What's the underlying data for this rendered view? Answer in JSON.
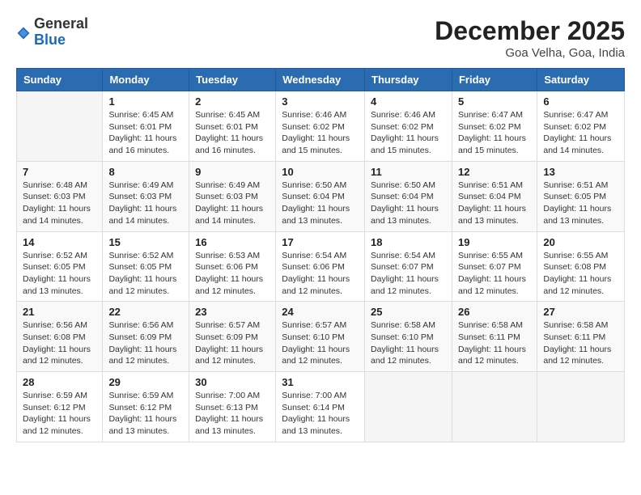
{
  "header": {
    "logo": {
      "general": "General",
      "blue": "Blue"
    },
    "title": "December 2025",
    "subtitle": "Goa Velha, Goa, India"
  },
  "columns": [
    "Sunday",
    "Monday",
    "Tuesday",
    "Wednesday",
    "Thursday",
    "Friday",
    "Saturday"
  ],
  "weeks": [
    [
      {
        "day": "",
        "info": ""
      },
      {
        "day": "1",
        "info": "Sunrise: 6:45 AM\nSunset: 6:01 PM\nDaylight: 11 hours\nand 16 minutes."
      },
      {
        "day": "2",
        "info": "Sunrise: 6:45 AM\nSunset: 6:01 PM\nDaylight: 11 hours\nand 16 minutes."
      },
      {
        "day": "3",
        "info": "Sunrise: 6:46 AM\nSunset: 6:02 PM\nDaylight: 11 hours\nand 15 minutes."
      },
      {
        "day": "4",
        "info": "Sunrise: 6:46 AM\nSunset: 6:02 PM\nDaylight: 11 hours\nand 15 minutes."
      },
      {
        "day": "5",
        "info": "Sunrise: 6:47 AM\nSunset: 6:02 PM\nDaylight: 11 hours\nand 15 minutes."
      },
      {
        "day": "6",
        "info": "Sunrise: 6:47 AM\nSunset: 6:02 PM\nDaylight: 11 hours\nand 14 minutes."
      }
    ],
    [
      {
        "day": "7",
        "info": "Sunrise: 6:48 AM\nSunset: 6:03 PM\nDaylight: 11 hours\nand 14 minutes."
      },
      {
        "day": "8",
        "info": "Sunrise: 6:49 AM\nSunset: 6:03 PM\nDaylight: 11 hours\nand 14 minutes."
      },
      {
        "day": "9",
        "info": "Sunrise: 6:49 AM\nSunset: 6:03 PM\nDaylight: 11 hours\nand 14 minutes."
      },
      {
        "day": "10",
        "info": "Sunrise: 6:50 AM\nSunset: 6:04 PM\nDaylight: 11 hours\nand 13 minutes."
      },
      {
        "day": "11",
        "info": "Sunrise: 6:50 AM\nSunset: 6:04 PM\nDaylight: 11 hours\nand 13 minutes."
      },
      {
        "day": "12",
        "info": "Sunrise: 6:51 AM\nSunset: 6:04 PM\nDaylight: 11 hours\nand 13 minutes."
      },
      {
        "day": "13",
        "info": "Sunrise: 6:51 AM\nSunset: 6:05 PM\nDaylight: 11 hours\nand 13 minutes."
      }
    ],
    [
      {
        "day": "14",
        "info": "Sunrise: 6:52 AM\nSunset: 6:05 PM\nDaylight: 11 hours\nand 13 minutes."
      },
      {
        "day": "15",
        "info": "Sunrise: 6:52 AM\nSunset: 6:05 PM\nDaylight: 11 hours\nand 12 minutes."
      },
      {
        "day": "16",
        "info": "Sunrise: 6:53 AM\nSunset: 6:06 PM\nDaylight: 11 hours\nand 12 minutes."
      },
      {
        "day": "17",
        "info": "Sunrise: 6:54 AM\nSunset: 6:06 PM\nDaylight: 11 hours\nand 12 minutes."
      },
      {
        "day": "18",
        "info": "Sunrise: 6:54 AM\nSunset: 6:07 PM\nDaylight: 11 hours\nand 12 minutes."
      },
      {
        "day": "19",
        "info": "Sunrise: 6:55 AM\nSunset: 6:07 PM\nDaylight: 11 hours\nand 12 minutes."
      },
      {
        "day": "20",
        "info": "Sunrise: 6:55 AM\nSunset: 6:08 PM\nDaylight: 11 hours\nand 12 minutes."
      }
    ],
    [
      {
        "day": "21",
        "info": "Sunrise: 6:56 AM\nSunset: 6:08 PM\nDaylight: 11 hours\nand 12 minutes."
      },
      {
        "day": "22",
        "info": "Sunrise: 6:56 AM\nSunset: 6:09 PM\nDaylight: 11 hours\nand 12 minutes."
      },
      {
        "day": "23",
        "info": "Sunrise: 6:57 AM\nSunset: 6:09 PM\nDaylight: 11 hours\nand 12 minutes."
      },
      {
        "day": "24",
        "info": "Sunrise: 6:57 AM\nSunset: 6:10 PM\nDaylight: 11 hours\nand 12 minutes."
      },
      {
        "day": "25",
        "info": "Sunrise: 6:58 AM\nSunset: 6:10 PM\nDaylight: 11 hours\nand 12 minutes."
      },
      {
        "day": "26",
        "info": "Sunrise: 6:58 AM\nSunset: 6:11 PM\nDaylight: 11 hours\nand 12 minutes."
      },
      {
        "day": "27",
        "info": "Sunrise: 6:58 AM\nSunset: 6:11 PM\nDaylight: 11 hours\nand 12 minutes."
      }
    ],
    [
      {
        "day": "28",
        "info": "Sunrise: 6:59 AM\nSunset: 6:12 PM\nDaylight: 11 hours\nand 12 minutes."
      },
      {
        "day": "29",
        "info": "Sunrise: 6:59 AM\nSunset: 6:12 PM\nDaylight: 11 hours\nand 13 minutes."
      },
      {
        "day": "30",
        "info": "Sunrise: 7:00 AM\nSunset: 6:13 PM\nDaylight: 11 hours\nand 13 minutes."
      },
      {
        "day": "31",
        "info": "Sunrise: 7:00 AM\nSunset: 6:14 PM\nDaylight: 11 hours\nand 13 minutes."
      },
      {
        "day": "",
        "info": ""
      },
      {
        "day": "",
        "info": ""
      },
      {
        "day": "",
        "info": ""
      }
    ]
  ]
}
